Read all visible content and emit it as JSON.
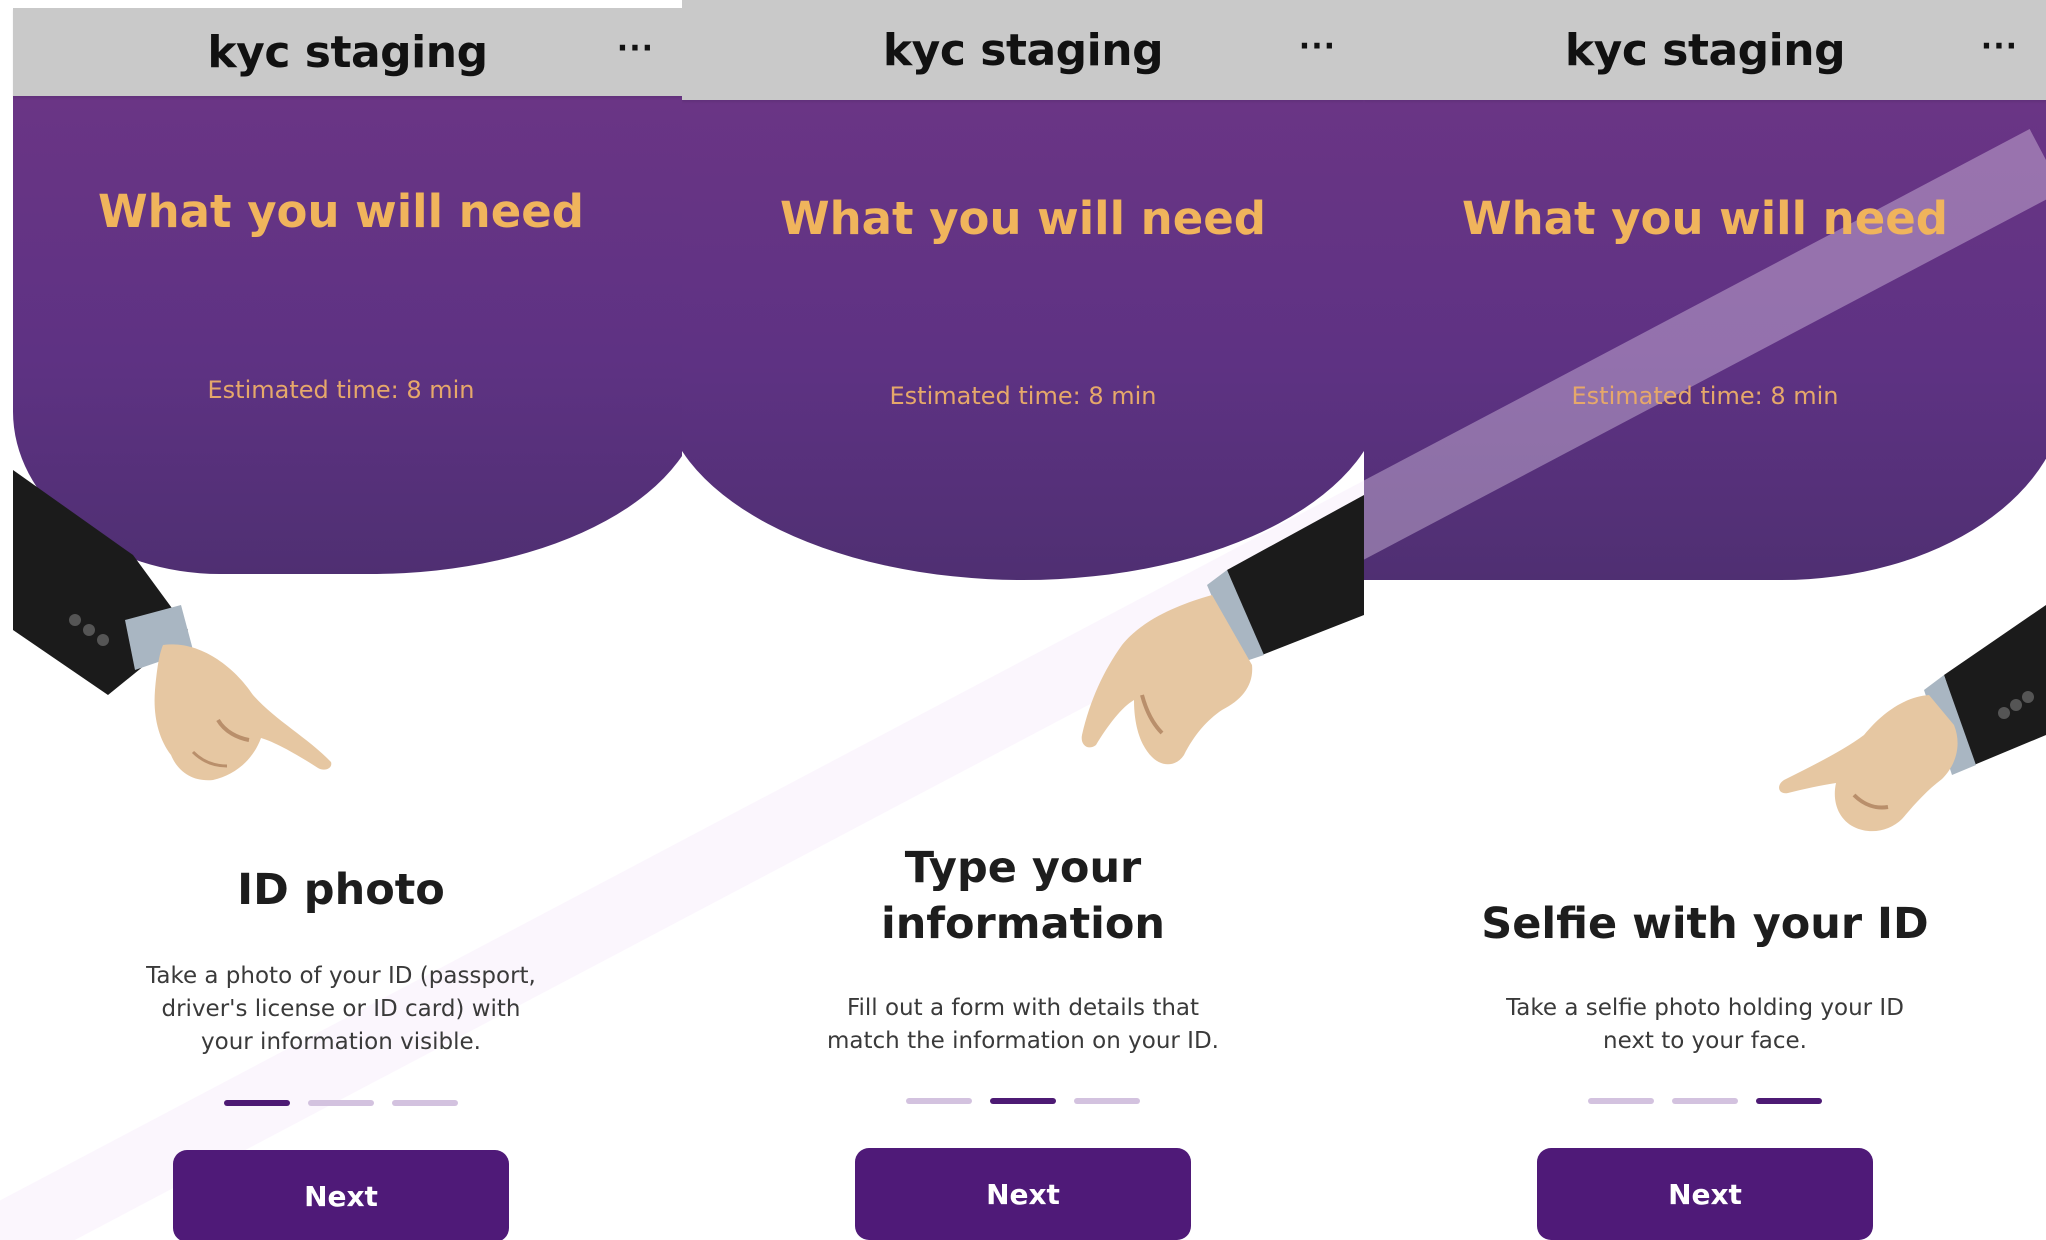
{
  "screens": [
    {
      "header_title": "kyc staging",
      "more_label": "···",
      "heading": "What you will need",
      "estimated": "Estimated time: 8 min",
      "step_title": "ID photo",
      "step_desc": "Take a photo of your ID (passport, driver's license or ID card) with your information visible.",
      "active_step": 0,
      "next_label": "Next"
    },
    {
      "header_title": "kyc staging",
      "more_label": "···",
      "heading": "What you will need",
      "estimated": "Estimated time: 8 min",
      "step_title": "Type your information",
      "step_desc": "Fill out a form with details that match the information on your ID.",
      "active_step": 1,
      "next_label": "Next"
    },
    {
      "header_title": "kyc staging",
      "more_label": "···",
      "heading": "What you will need",
      "estimated": "Estimated time: 8 min",
      "step_title": "Selfie with your ID",
      "step_desc": "Take a selfie photo holding your ID next to your face.",
      "active_step": 2,
      "next_label": "Next"
    }
  ],
  "colors": {
    "accent_purple": "#4f1a78",
    "heading_gold": "#f0b45c",
    "header_gray": "#c9c9c9"
  }
}
